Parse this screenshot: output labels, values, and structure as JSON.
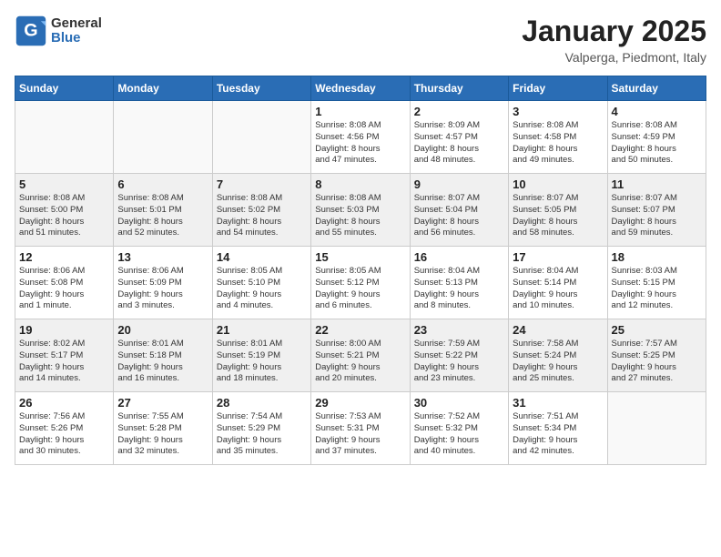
{
  "logo": {
    "general": "General",
    "blue": "Blue"
  },
  "title": "January 2025",
  "subtitle": "Valperga, Piedmont, Italy",
  "weekdays": [
    "Sunday",
    "Monday",
    "Tuesday",
    "Wednesday",
    "Thursday",
    "Friday",
    "Saturday"
  ],
  "weeks": [
    [
      {
        "day": "",
        "info": ""
      },
      {
        "day": "",
        "info": ""
      },
      {
        "day": "",
        "info": ""
      },
      {
        "day": "1",
        "info": "Sunrise: 8:08 AM\nSunset: 4:56 PM\nDaylight: 8 hours\nand 47 minutes."
      },
      {
        "day": "2",
        "info": "Sunrise: 8:09 AM\nSunset: 4:57 PM\nDaylight: 8 hours\nand 48 minutes."
      },
      {
        "day": "3",
        "info": "Sunrise: 8:08 AM\nSunset: 4:58 PM\nDaylight: 8 hours\nand 49 minutes."
      },
      {
        "day": "4",
        "info": "Sunrise: 8:08 AM\nSunset: 4:59 PM\nDaylight: 8 hours\nand 50 minutes."
      }
    ],
    [
      {
        "day": "5",
        "info": "Sunrise: 8:08 AM\nSunset: 5:00 PM\nDaylight: 8 hours\nand 51 minutes."
      },
      {
        "day": "6",
        "info": "Sunrise: 8:08 AM\nSunset: 5:01 PM\nDaylight: 8 hours\nand 52 minutes."
      },
      {
        "day": "7",
        "info": "Sunrise: 8:08 AM\nSunset: 5:02 PM\nDaylight: 8 hours\nand 54 minutes."
      },
      {
        "day": "8",
        "info": "Sunrise: 8:08 AM\nSunset: 5:03 PM\nDaylight: 8 hours\nand 55 minutes."
      },
      {
        "day": "9",
        "info": "Sunrise: 8:07 AM\nSunset: 5:04 PM\nDaylight: 8 hours\nand 56 minutes."
      },
      {
        "day": "10",
        "info": "Sunrise: 8:07 AM\nSunset: 5:05 PM\nDaylight: 8 hours\nand 58 minutes."
      },
      {
        "day": "11",
        "info": "Sunrise: 8:07 AM\nSunset: 5:07 PM\nDaylight: 8 hours\nand 59 minutes."
      }
    ],
    [
      {
        "day": "12",
        "info": "Sunrise: 8:06 AM\nSunset: 5:08 PM\nDaylight: 9 hours\nand 1 minute."
      },
      {
        "day": "13",
        "info": "Sunrise: 8:06 AM\nSunset: 5:09 PM\nDaylight: 9 hours\nand 3 minutes."
      },
      {
        "day": "14",
        "info": "Sunrise: 8:05 AM\nSunset: 5:10 PM\nDaylight: 9 hours\nand 4 minutes."
      },
      {
        "day": "15",
        "info": "Sunrise: 8:05 AM\nSunset: 5:12 PM\nDaylight: 9 hours\nand 6 minutes."
      },
      {
        "day": "16",
        "info": "Sunrise: 8:04 AM\nSunset: 5:13 PM\nDaylight: 9 hours\nand 8 minutes."
      },
      {
        "day": "17",
        "info": "Sunrise: 8:04 AM\nSunset: 5:14 PM\nDaylight: 9 hours\nand 10 minutes."
      },
      {
        "day": "18",
        "info": "Sunrise: 8:03 AM\nSunset: 5:15 PM\nDaylight: 9 hours\nand 12 minutes."
      }
    ],
    [
      {
        "day": "19",
        "info": "Sunrise: 8:02 AM\nSunset: 5:17 PM\nDaylight: 9 hours\nand 14 minutes."
      },
      {
        "day": "20",
        "info": "Sunrise: 8:01 AM\nSunset: 5:18 PM\nDaylight: 9 hours\nand 16 minutes."
      },
      {
        "day": "21",
        "info": "Sunrise: 8:01 AM\nSunset: 5:19 PM\nDaylight: 9 hours\nand 18 minutes."
      },
      {
        "day": "22",
        "info": "Sunrise: 8:00 AM\nSunset: 5:21 PM\nDaylight: 9 hours\nand 20 minutes."
      },
      {
        "day": "23",
        "info": "Sunrise: 7:59 AM\nSunset: 5:22 PM\nDaylight: 9 hours\nand 23 minutes."
      },
      {
        "day": "24",
        "info": "Sunrise: 7:58 AM\nSunset: 5:24 PM\nDaylight: 9 hours\nand 25 minutes."
      },
      {
        "day": "25",
        "info": "Sunrise: 7:57 AM\nSunset: 5:25 PM\nDaylight: 9 hours\nand 27 minutes."
      }
    ],
    [
      {
        "day": "26",
        "info": "Sunrise: 7:56 AM\nSunset: 5:26 PM\nDaylight: 9 hours\nand 30 minutes."
      },
      {
        "day": "27",
        "info": "Sunrise: 7:55 AM\nSunset: 5:28 PM\nDaylight: 9 hours\nand 32 minutes."
      },
      {
        "day": "28",
        "info": "Sunrise: 7:54 AM\nSunset: 5:29 PM\nDaylight: 9 hours\nand 35 minutes."
      },
      {
        "day": "29",
        "info": "Sunrise: 7:53 AM\nSunset: 5:31 PM\nDaylight: 9 hours\nand 37 minutes."
      },
      {
        "day": "30",
        "info": "Sunrise: 7:52 AM\nSunset: 5:32 PM\nDaylight: 9 hours\nand 40 minutes."
      },
      {
        "day": "31",
        "info": "Sunrise: 7:51 AM\nSunset: 5:34 PM\nDaylight: 9 hours\nand 42 minutes."
      },
      {
        "day": "",
        "info": ""
      }
    ]
  ]
}
